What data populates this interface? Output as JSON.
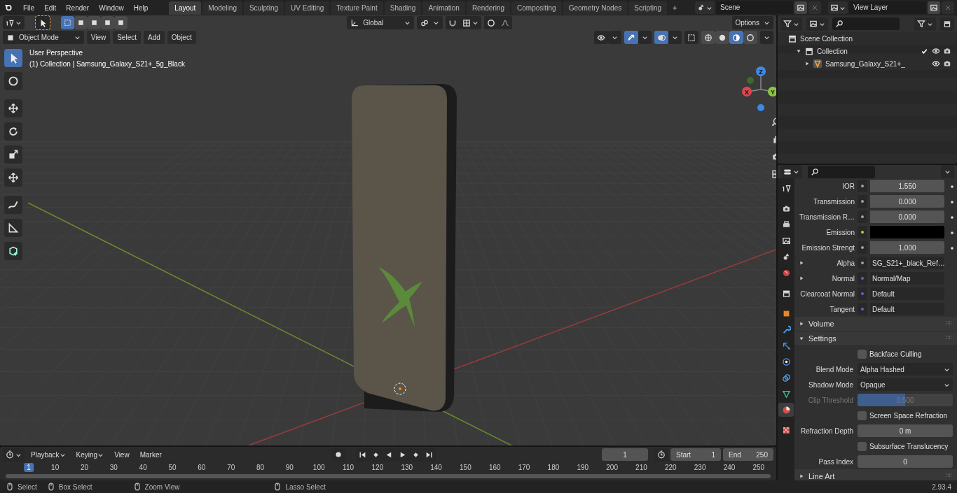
{
  "menus": [
    "File",
    "Edit",
    "Render",
    "Window",
    "Help"
  ],
  "workspaces": [
    {
      "label": "Layout",
      "selected": true
    },
    {
      "label": "Modeling",
      "selected": false
    },
    {
      "label": "Sculpting",
      "selected": false
    },
    {
      "label": "UV Editing",
      "selected": false
    },
    {
      "label": "Texture Paint",
      "selected": false
    },
    {
      "label": "Shading",
      "selected": false
    },
    {
      "label": "Animation",
      "selected": false
    },
    {
      "label": "Rendering",
      "selected": false
    },
    {
      "label": "Compositing",
      "selected": false
    },
    {
      "label": "Geometry Nodes",
      "selected": false
    },
    {
      "label": "Scripting",
      "selected": false
    }
  ],
  "add_workspace": "+",
  "scene": "Scene",
  "view_layer": "View Layer",
  "viewport": {
    "mode": "Object Mode",
    "menus": [
      "View",
      "Select",
      "Add",
      "Object"
    ],
    "transform_orientation": "Global",
    "options": "Options",
    "select_modes": [
      {
        "selected": true
      },
      {
        "selected": false
      },
      {
        "selected": false
      },
      {
        "selected": false
      },
      {
        "selected": false
      }
    ],
    "shading_modes": [
      {
        "selected": false
      },
      {
        "selected": false
      },
      {
        "selected": true
      },
      {
        "selected": false
      }
    ],
    "overlay_lines": [
      "User Perspective",
      "(1) Collection | Samsung_Galaxy_S21+_5g_Black"
    ],
    "tools": [
      {
        "selected": true
      },
      {
        "selected": false
      },
      {
        "selected": false
      },
      {
        "selected": false
      },
      {
        "selected": false
      },
      {
        "selected": false
      },
      {
        "selected": false
      },
      {
        "selected": false
      },
      {
        "selected": false
      }
    ],
    "gizmo_axes": [
      "X",
      "Y",
      "Z"
    ]
  },
  "outliner": {
    "items": [
      {
        "label": "Scene Collection",
        "children": [
          {
            "label": "Collection",
            "expanded": true,
            "checked": true,
            "children": [
              {
                "label": "Samsung_Galaxy_S21+_",
                "expanded": false
              }
            ]
          }
        ]
      }
    ]
  },
  "properties": {
    "tabs": [
      {
        "selected": false
      },
      {
        "selected": false
      },
      {
        "selected": false
      },
      {
        "selected": false
      },
      {
        "selected": false
      },
      {
        "selected": false
      },
      {
        "selected": false
      },
      {
        "selected": false
      },
      {
        "selected": false
      },
      {
        "selected": false
      },
      {
        "selected": false
      },
      {
        "selected": false
      },
      {
        "selected": false
      },
      {
        "selected": true
      },
      {
        "selected": false
      }
    ],
    "rows": [
      {
        "kind": "number",
        "color": "#a1a1a1",
        "label": "IOR",
        "value": "1.550"
      },
      {
        "kind": "number",
        "color": "#a1a1a1",
        "label": "Transmission",
        "value": "0.000"
      },
      {
        "kind": "number",
        "color": "#a1a1a1",
        "label": "Transmission R…",
        "value": "0.000"
      },
      {
        "kind": "swatch",
        "color": "#c7c729",
        "label": "Emission"
      },
      {
        "kind": "number",
        "color": "#a1a1a1",
        "label": "Emission Strengt",
        "value": "1.000"
      },
      {
        "kind": "link",
        "color": "#a1a1a1",
        "label": "Alpha",
        "value": "SG_S21+_black_Ref…",
        "expanded": false
      },
      {
        "kind": "link",
        "color": "#6363c7",
        "label": "Normal",
        "value": "Normal/Map",
        "expanded": false
      },
      {
        "kind": "link",
        "color": "#6363c7",
        "label": "Clearcoat Normal",
        "value": "Default"
      },
      {
        "kind": "link",
        "color": "#6363c7",
        "label": "Tangent",
        "value": "Default"
      }
    ],
    "panels": [
      {
        "title": "Volume",
        "expanded": false
      },
      {
        "title": "Settings",
        "expanded": true,
        "rows": [
          {
            "kind": "checkbox",
            "label": "Backface Culling",
            "checked": false
          },
          {
            "kind": "dropdown",
            "label": "Blend Mode",
            "value": "Alpha Hashed"
          },
          {
            "kind": "dropdown",
            "label": "Shadow Mode",
            "value": "Opaque"
          },
          {
            "kind": "slider",
            "label": "Clip Threshold",
            "value": "0.500",
            "level": 0.5,
            "disabled": true
          },
          {
            "kind": "checkbox",
            "label": "Screen Space Refraction",
            "checked": false
          },
          {
            "kind": "number",
            "label": "Refraction Depth",
            "value": "0 m"
          },
          {
            "kind": "checkbox",
            "label": "Subsurface Translucency",
            "checked": false
          },
          {
            "kind": "number",
            "label": "Pass Index",
            "value": "0"
          }
        ]
      },
      {
        "title": "Line Art",
        "expanded": false
      }
    ]
  },
  "timeline": {
    "menus": [
      {
        "label": "Playback",
        "dropdown": true
      },
      {
        "label": "Keying",
        "dropdown": true
      },
      {
        "label": "View",
        "dropdown": false
      },
      {
        "label": "Marker",
        "dropdown": false
      }
    ],
    "current_frame": "1",
    "start_label": "Start",
    "start": "1",
    "end_label": "End",
    "end": "250",
    "ticks": [
      {
        "label": "1",
        "selected": true
      },
      {
        "label": "10",
        "selected": false
      },
      {
        "label": "20",
        "selected": false
      },
      {
        "label": "30",
        "selected": false
      },
      {
        "label": "40",
        "selected": false
      },
      {
        "label": "50",
        "selected": false
      },
      {
        "label": "60",
        "selected": false
      },
      {
        "label": "70",
        "selected": false
      },
      {
        "label": "80",
        "selected": false
      },
      {
        "label": "90",
        "selected": false
      },
      {
        "label": "100",
        "selected": false
      },
      {
        "label": "110",
        "selected": false
      },
      {
        "label": "120",
        "selected": false
      },
      {
        "label": "130",
        "selected": false
      },
      {
        "label": "140",
        "selected": false
      },
      {
        "label": "150",
        "selected": false
      },
      {
        "label": "160",
        "selected": false
      },
      {
        "label": "170",
        "selected": false
      },
      {
        "label": "180",
        "selected": false
      },
      {
        "label": "190",
        "selected": false
      },
      {
        "label": "200",
        "selected": false
      },
      {
        "label": "210",
        "selected": false
      },
      {
        "label": "220",
        "selected": false
      },
      {
        "label": "230",
        "selected": false
      },
      {
        "label": "240",
        "selected": false
      },
      {
        "label": "250",
        "selected": false
      }
    ]
  },
  "status_bar": {
    "hints": [
      "Select",
      "Box Select",
      "Zoom View",
      "Lasso Select"
    ],
    "version": "2.93.4"
  }
}
